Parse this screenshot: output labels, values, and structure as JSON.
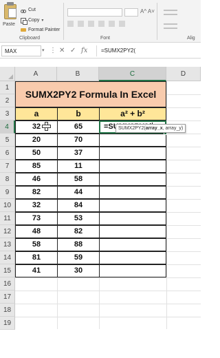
{
  "ribbon": {
    "paste_label": "Paste",
    "cut_label": "Cut",
    "copy_label": "Copy",
    "format_painter_label": "Format Painter",
    "clipboard_group": "Clipboard",
    "font_group": "Font",
    "alignment_group_partial": "Alig"
  },
  "formula_bar": {
    "name_box": "MAX",
    "fx": "fx",
    "formula": "=SUMX2PY2("
  },
  "columns": [
    "A",
    "B",
    "C",
    "D"
  ],
  "rows": [
    "1",
    "2",
    "3",
    "4",
    "5",
    "6",
    "7",
    "8",
    "9",
    "10",
    "11",
    "12",
    "13",
    "14",
    "15",
    "16",
    "17",
    "18",
    "19"
  ],
  "sheet": {
    "title": "SUMX2PY2 Formula In Excel",
    "header_a": "a",
    "header_b": "b",
    "header_c": "a² + b²",
    "active_cell_text": "=SUMX2PY2(",
    "tooltip_func": "SUMX2PY2(",
    "tooltip_arg1": "array_x",
    "tooltip_rest": ", array_y)",
    "data": [
      {
        "a": "32",
        "b": "65"
      },
      {
        "a": "20",
        "b": "70"
      },
      {
        "a": "50",
        "b": "37"
      },
      {
        "a": "85",
        "b": "11"
      },
      {
        "a": "46",
        "b": "58"
      },
      {
        "a": "82",
        "b": "44"
      },
      {
        "a": "32",
        "b": "84"
      },
      {
        "a": "73",
        "b": "53"
      },
      {
        "a": "48",
        "b": "82"
      },
      {
        "a": "58",
        "b": "88"
      },
      {
        "a": "81",
        "b": "59"
      },
      {
        "a": "41",
        "b": "30"
      }
    ]
  },
  "colors": {
    "title_fill": "#f8cbad",
    "header_fill": "#ffe699",
    "excel_green": "#217346"
  }
}
